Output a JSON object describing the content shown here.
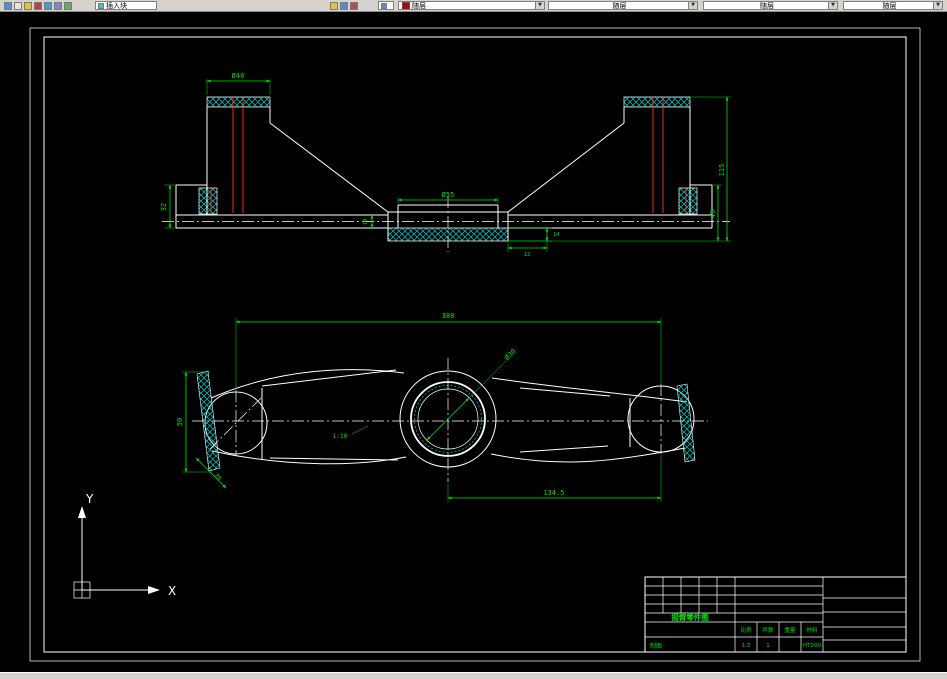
{
  "toolbar": {
    "insert_block_label": "插入块",
    "color_value": "随层",
    "linetype_value": "随层",
    "lineweight_value": "随层",
    "plotstyle_value": "随层"
  },
  "front_view": {
    "dims": {
      "tower_dia": "Ø40",
      "hub_dia": "Ø55",
      "right_inner": "45",
      "total_height": "115",
      "left_height": "32",
      "base_thickness": "10",
      "hub_band": "14",
      "hub_offset": "12"
    }
  },
  "plan_view": {
    "dims": {
      "length": "380",
      "center_distance": "134.5",
      "end_width": "50",
      "end_offset": "20",
      "bore_dia": "Ø30",
      "taper": "1:10"
    }
  },
  "ucs": {
    "x_label": "X",
    "y_label": "Y"
  },
  "title_block": {
    "part_name": "摇臂零件图",
    "drafter_label": "制图",
    "info_labels": [
      "比例",
      "件数",
      "重量",
      "材料"
    ],
    "scale_value": "1:2",
    "count_value": "1",
    "material_value": "HT200"
  }
}
